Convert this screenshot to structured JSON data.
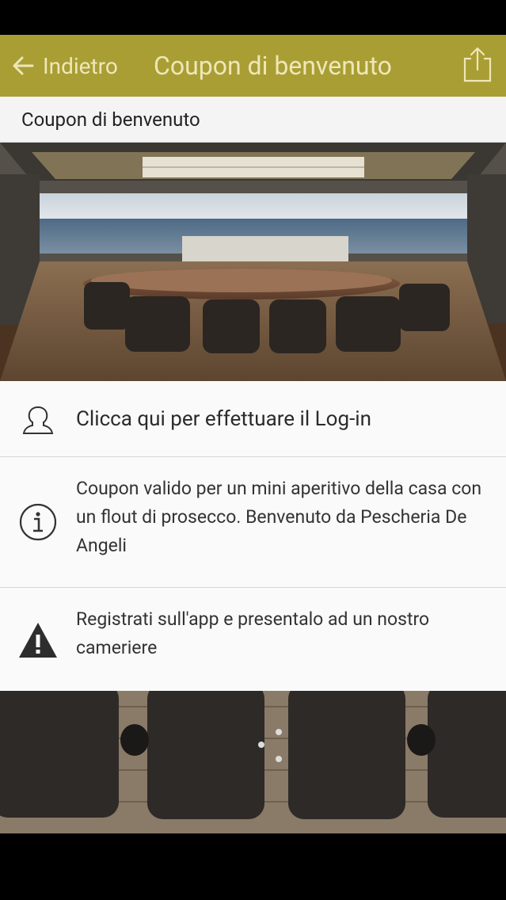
{
  "nav": {
    "back_label": "Indietro",
    "title": "Coupon di benvenuto"
  },
  "section": {
    "title": "Coupon di benvenuto"
  },
  "hero": {
    "alt": "Yacht deck dining area with sea view"
  },
  "rows": {
    "login": {
      "text": "Clicca qui per effettuare il Log-in",
      "icon": "user-icon"
    },
    "info": {
      "text": "Coupon valido per un mini aperitivo della casa con un flout di prosecco.  Benvenuto da Pescheria De Angeli",
      "icon": "info-icon"
    },
    "warning": {
      "text": "Registrati sull'app e presentalo ad un nostro cameriere",
      "icon": "warning-icon"
    }
  },
  "colors": {
    "nav_bg": "#a99e34",
    "nav_text": "#efe7b8",
    "row_bg": "#fafafa"
  }
}
